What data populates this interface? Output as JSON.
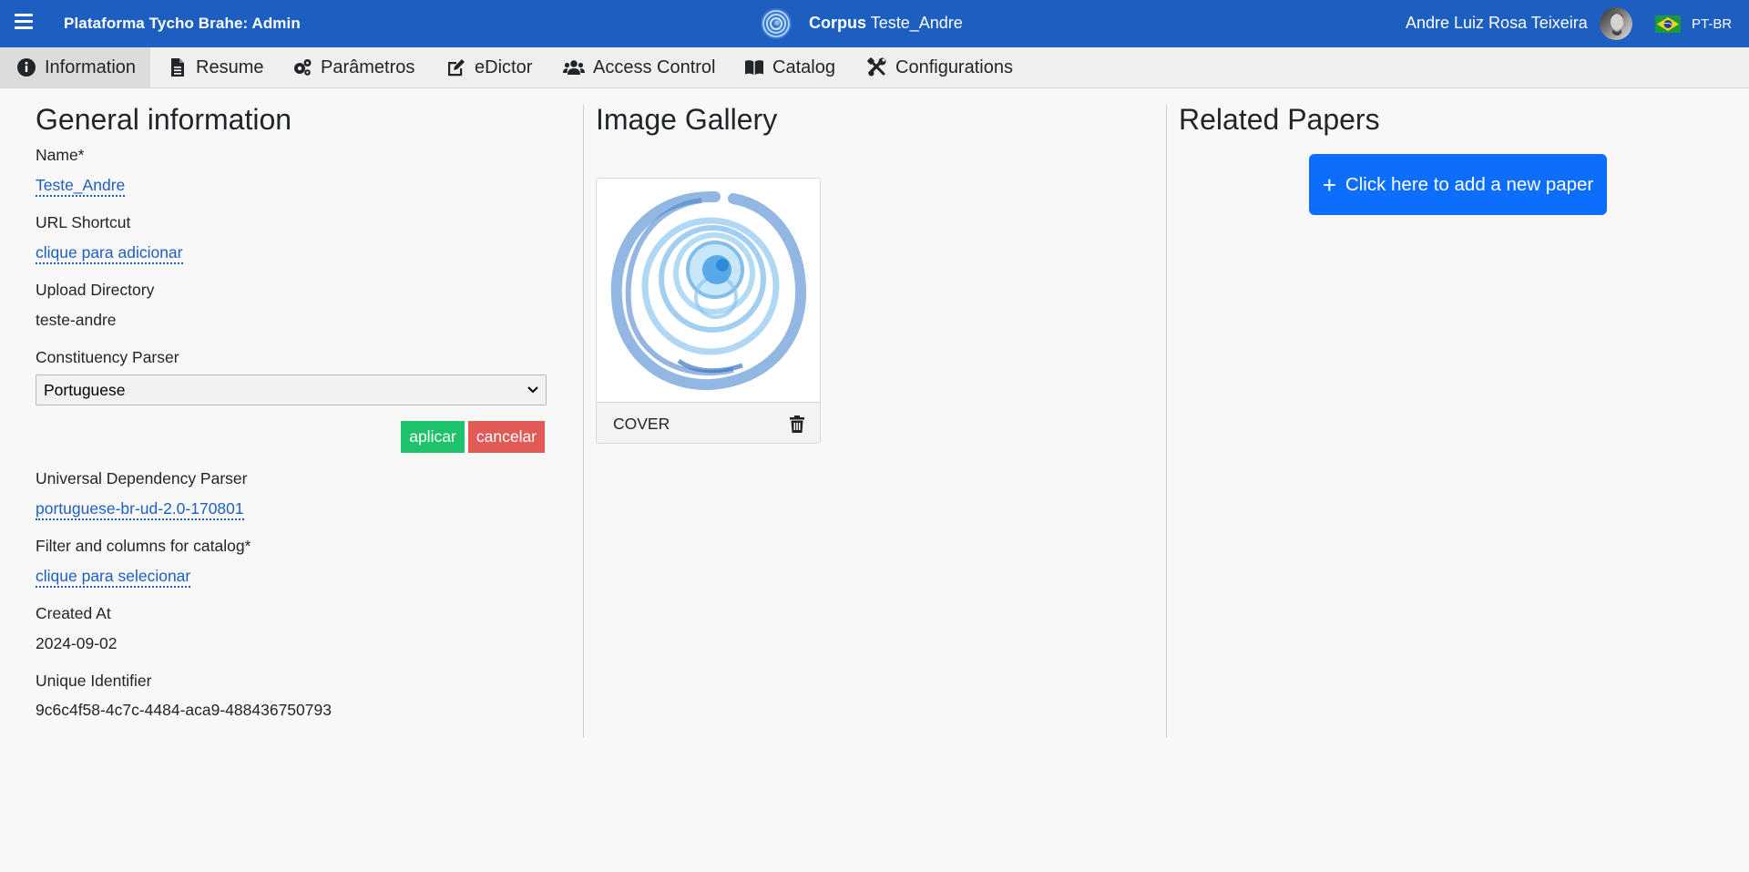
{
  "header": {
    "app_title": "Plataforma Tycho Brahe: Admin",
    "corpus_label": "Corpus",
    "corpus_name": "Teste_Andre",
    "user_name": "Andre Luiz Rosa Teixeira",
    "language": "PT-BR",
    "icons": [
      "menu-icon",
      "corpus-logo-icon",
      "user-avatar",
      "brazil-flag-icon"
    ]
  },
  "tabs": [
    {
      "label": "Information",
      "icon": "info-circle-icon",
      "active": true
    },
    {
      "label": "Resume",
      "icon": "file-icon"
    },
    {
      "label": "Parâmetros",
      "icon": "gears-icon"
    },
    {
      "label": "eDictor",
      "icon": "edit-icon"
    },
    {
      "label": "Access Control",
      "icon": "users-icon"
    },
    {
      "label": "Catalog",
      "icon": "book-icon"
    },
    {
      "label": "Configurations",
      "icon": "tools-icon"
    }
  ],
  "general": {
    "title": "General information",
    "name_label": "Name*",
    "name_value": "Teste_Andre",
    "url_label": "URL Shortcut",
    "url_value": "clique para adicionar",
    "upload_label": "Upload Directory",
    "upload_value": "teste-andre",
    "parser_label": "Constituency Parser",
    "parser_value": "Portuguese",
    "apply_label": "aplicar",
    "cancel_label": "cancelar",
    "ud_label": "Universal Dependency Parser",
    "ud_value": "portuguese-br-ud-2.0-170801",
    "filter_label": "Filter and columns for catalog*",
    "filter_value": "clique para selecionar",
    "created_label": "Created At",
    "created_value": "2024-09-02",
    "uid_label": "Unique Identifier",
    "uid_value": "9c6c4f58-4c7c-4484-aca9-488436750793"
  },
  "gallery": {
    "title": "Image Gallery",
    "items": [
      {
        "caption": "COVER"
      }
    ]
  },
  "papers": {
    "title": "Related Papers",
    "add_label": "Click here to add a new paper"
  },
  "colors": {
    "topbar": "#1d5fc0",
    "link": "#1d5fc0",
    "apply": "#1ec26a",
    "cancel": "#e05a56",
    "primary": "#0d6efd"
  }
}
